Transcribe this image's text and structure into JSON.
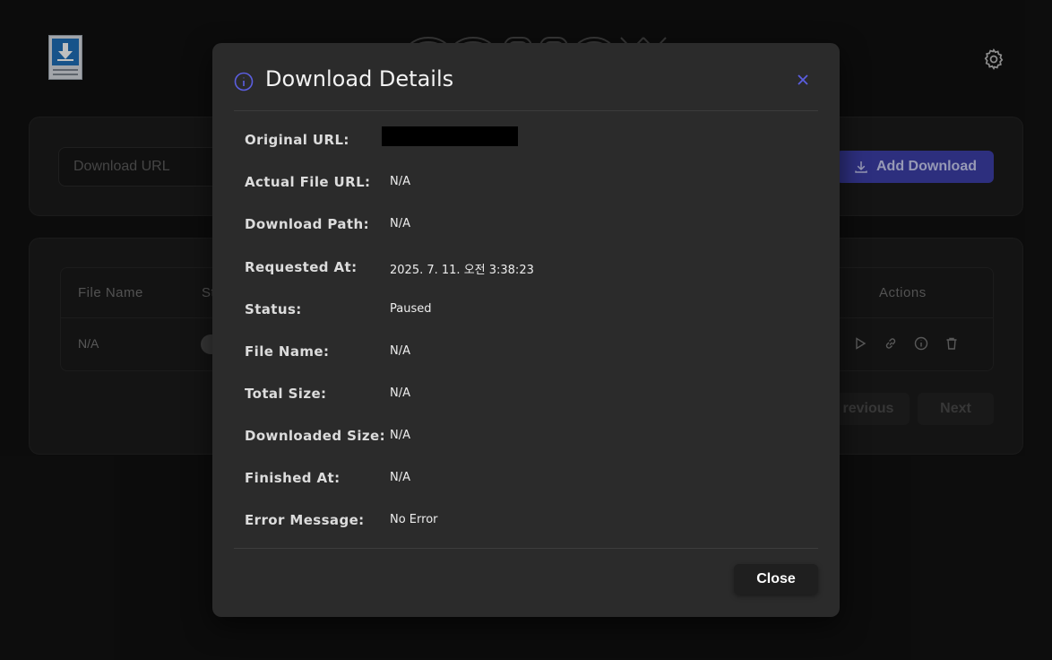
{
  "app": {
    "icon": "download-file-icon",
    "settings_icon": "gear-icon"
  },
  "download_form": {
    "url_placeholder": "Download URL",
    "add_button_label": "Add Download",
    "add_button_icon": "download-icon"
  },
  "table": {
    "columns": [
      "File Name",
      "St",
      "Actions"
    ],
    "rows": [
      {
        "file_name": "N/A"
      }
    ],
    "action_icons": [
      "play-icon",
      "link-icon",
      "info-icon",
      "trash-icon"
    ]
  },
  "pagination": {
    "previous_label": "revious",
    "next_label": "Next"
  },
  "modal": {
    "title": "Download Details",
    "title_icon": "info-icon",
    "close_icon": "close-icon",
    "fields": [
      {
        "label": "Original URL:",
        "value": ""
      },
      {
        "label": "Actual File URL:",
        "value": "N/A"
      },
      {
        "label": "Download Path:",
        "value": "N/A"
      },
      {
        "label": "Requested At:",
        "value": "2025. 7. 11. 오전 3:38:23"
      },
      {
        "label": "Status:",
        "value": "Paused"
      },
      {
        "label": "File Name:",
        "value": "N/A"
      },
      {
        "label": "Total Size:",
        "value": "N/A"
      },
      {
        "label": "Downloaded Size:",
        "value": "N/A"
      },
      {
        "label": "Finished At:",
        "value": "N/A"
      },
      {
        "label": "Error Message:",
        "value": "No Error"
      }
    ],
    "close_button_label": "Close"
  },
  "colors": {
    "background": "#111111",
    "modal": "#2b2b2b",
    "accent": "#3d3fa8",
    "info_icon": "#5b5ee0"
  }
}
